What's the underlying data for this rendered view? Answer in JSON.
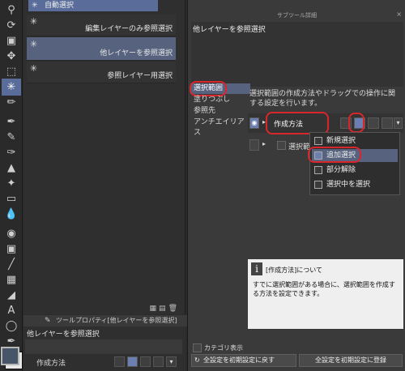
{
  "toolbar": {
    "icons": [
      "zoom-icon",
      "rotate-icon",
      "layer-move-icon",
      "move-icon",
      "marquee-icon",
      "auto-select-icon",
      "eyedropper-icon",
      "pen-icon",
      "pencil-icon",
      "brush-icon",
      "airbrush-icon",
      "decoration-icon",
      "eraser-icon",
      "blend-icon",
      "fill-icon",
      "gradient-icon",
      "figure-icon",
      "frame-icon",
      "ruler-icon",
      "text-icon",
      "balloon-icon",
      "correction-icon"
    ]
  },
  "subtool": {
    "tab_label": "自動選択",
    "items": [
      {
        "label": "編集レイヤーのみ参照選択",
        "selected": false
      },
      {
        "label": "他レイヤーを参照選択",
        "selected": true
      },
      {
        "label": "参照レイヤー用選択",
        "selected": false
      }
    ]
  },
  "tool_property": {
    "header": "ツールプロパティ[他レイヤーを参照選択]",
    "title": "他レイヤーを参照選択",
    "method_label": "作成方法"
  },
  "detail": {
    "window_title": "サブツール詳細",
    "close": "×",
    "tool_name": "他レイヤーを参照選択",
    "categories": [
      "選択範囲",
      "塗りつぶし",
      "参照先",
      "アンチエイリアス"
    ],
    "selected_category": "選択範囲",
    "description": "選択範囲の作成方法やドラッグでの操作に関する設定を行います。",
    "method_label": "作成方法",
    "option_label": "選択範",
    "dropdown": [
      {
        "label": "新規選択",
        "highlighted": false
      },
      {
        "label": "追加選択",
        "highlighted": true
      },
      {
        "label": "部分解除",
        "highlighted": false
      },
      {
        "label": "選択中を選択",
        "highlighted": false
      }
    ],
    "info_title": "[作成方法]について",
    "info_body": "すでに選択範囲がある場合に、選択範囲を作成する方法を設定できます。",
    "category_display": "カテゴリ表示",
    "reset_button": "全設定を初期設定に戻す",
    "register_button": "全設定を初期設定に登録"
  },
  "colors": {
    "accent": "#56627e",
    "highlight_ring": "#d9262b"
  }
}
